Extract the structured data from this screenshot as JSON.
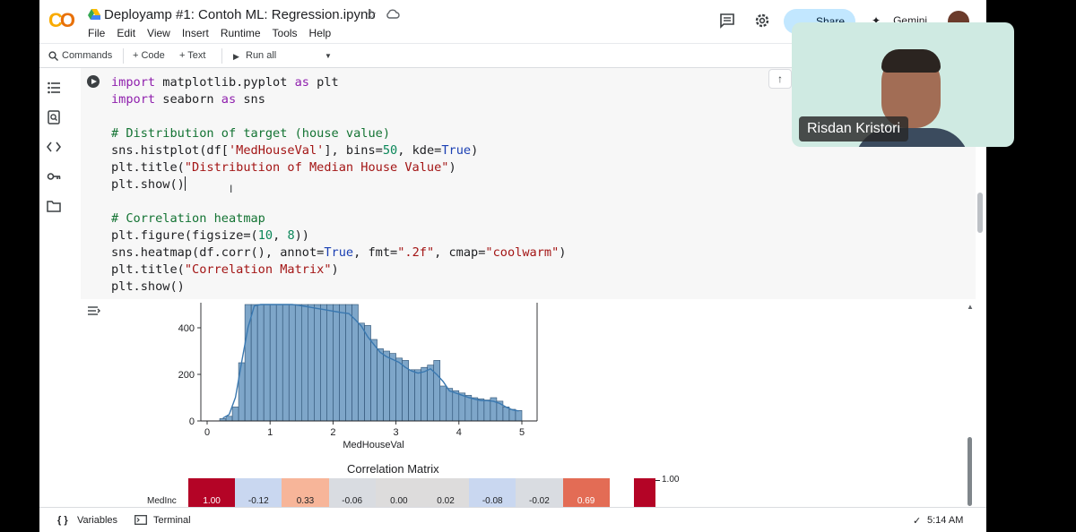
{
  "header": {
    "title": "Deployamp #1: Contoh ML: Regression.ipynb",
    "menu": [
      "File",
      "Edit",
      "View",
      "Insert",
      "Runtime",
      "Tools",
      "Help"
    ],
    "share_label": "Share",
    "gemini_label": "Gemini"
  },
  "toolbar": {
    "commands_label": "Commands",
    "code_label": "+ Code",
    "text_label": "+ Text",
    "run_all_label": "Run all"
  },
  "code_lines": [
    "import matplotlib.pyplot as plt",
    "import seaborn as sns",
    "",
    "# Distribution of target (house value)",
    "sns.histplot(df['MedHouseVal'], bins=50, kde=True)",
    "plt.title(\"Distribution of Median House Value\")",
    "plt.show()",
    "",
    "# Correlation heatmap",
    "plt.figure(figsize=(10, 8))",
    "sns.heatmap(df.corr(), annot=True, fmt=\".2f\", cmap=\"coolwarm\")",
    "plt.title(\"Correlation Matrix\")",
    "plt.show()"
  ],
  "chart_data": [
    {
      "type": "bar",
      "xlabel": "MedHouseVal",
      "ylabel": "",
      "xlim": [
        0,
        5
      ],
      "ylim": [
        0,
        500
      ],
      "xticks": [
        0,
        1,
        2,
        3,
        4,
        5
      ],
      "yticks": [
        0,
        200,
        400
      ],
      "bins": [
        0.2,
        0.3,
        0.4,
        0.5,
        0.6,
        0.7,
        0.8,
        0.9,
        1.0,
        1.1,
        1.2,
        1.3,
        1.4,
        1.5,
        1.6,
        1.7,
        1.8,
        1.9,
        2.0,
        2.1,
        2.2,
        2.3,
        2.4,
        2.5,
        2.6,
        2.7,
        2.8,
        2.9,
        3.0,
        3.1,
        3.2,
        3.3,
        3.4,
        3.5,
        3.6,
        3.7,
        3.8,
        3.9,
        4.0,
        4.1,
        4.2,
        4.3,
        4.4,
        4.5,
        4.6,
        4.7,
        4.8,
        4.9
      ],
      "values": [
        10,
        20,
        60,
        250,
        520,
        540,
        550,
        560,
        560,
        555,
        550,
        545,
        540,
        535,
        530,
        525,
        520,
        515,
        510,
        505,
        500,
        500,
        420,
        410,
        350,
        310,
        300,
        290,
        270,
        260,
        220,
        220,
        230,
        240,
        260,
        150,
        140,
        130,
        120,
        110,
        100,
        95,
        90,
        100,
        85,
        60,
        50,
        45
      ],
      "kde": true,
      "top_bin_value": 520
    },
    {
      "type": "heatmap",
      "title": "Correlation Matrix",
      "row_labels": [
        "MedInc"
      ],
      "values": [
        [
          "1.00",
          "-0.12",
          "0.33",
          "-0.06",
          "0.00",
          "0.02",
          "-0.08",
          "-0.02",
          "0.69"
        ]
      ],
      "colors": [
        "#b40426",
        "#c9d7f0",
        "#f7b599",
        "#d9dce1",
        "#dddcdc",
        "#dddcdc",
        "#c9d7f0",
        "#d9dce1",
        "#e36c55"
      ],
      "colorbar_label": "1.00"
    }
  ],
  "statusbar": {
    "variables_label": "Variables",
    "terminal_label": "Terminal",
    "time": "5:14 AM"
  },
  "video": {
    "name": "Risdan Kristori"
  }
}
